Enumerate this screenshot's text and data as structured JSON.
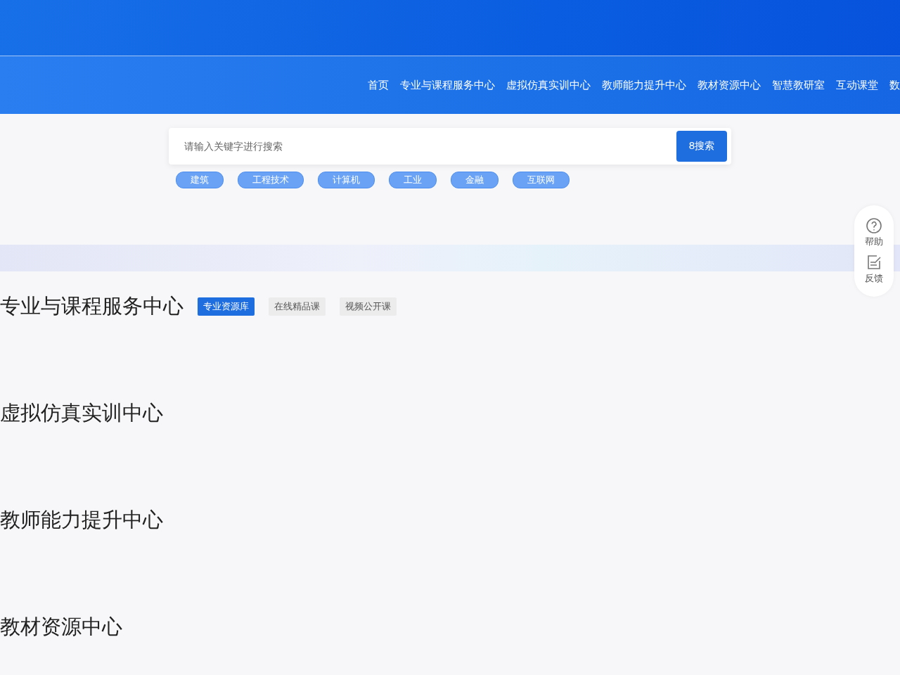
{
  "nav": {
    "items": [
      {
        "label": "首页"
      },
      {
        "label": "专业与课程服务中心"
      },
      {
        "label": "虚拟仿真实训中心"
      },
      {
        "label": "教师能力提升中心"
      },
      {
        "label": "教材资源中心"
      },
      {
        "label": "智慧教研室"
      },
      {
        "label": "互动课堂"
      },
      {
        "label": "数"
      }
    ]
  },
  "search": {
    "placeholder": "请输入关键字进行搜索",
    "button": "8搜索"
  },
  "tags": [
    "建筑",
    "工程技术",
    "计算机",
    "工业",
    "金融",
    "互联网"
  ],
  "side_tools": [
    {
      "kind": "help",
      "label": "帮助"
    },
    {
      "kind": "feedback",
      "label": "反馈"
    }
  ],
  "sections": [
    {
      "title": "专业与课程服务中心",
      "tabs": [
        {
          "label": "专业资源库",
          "selected": true
        },
        {
          "label": "在线精品课",
          "selected": false
        },
        {
          "label": "视频公开课",
          "selected": false
        }
      ]
    },
    {
      "title": "虚拟仿真实训中心"
    },
    {
      "title": "教师能力提升中心"
    },
    {
      "title": "教材资源中心"
    }
  ]
}
